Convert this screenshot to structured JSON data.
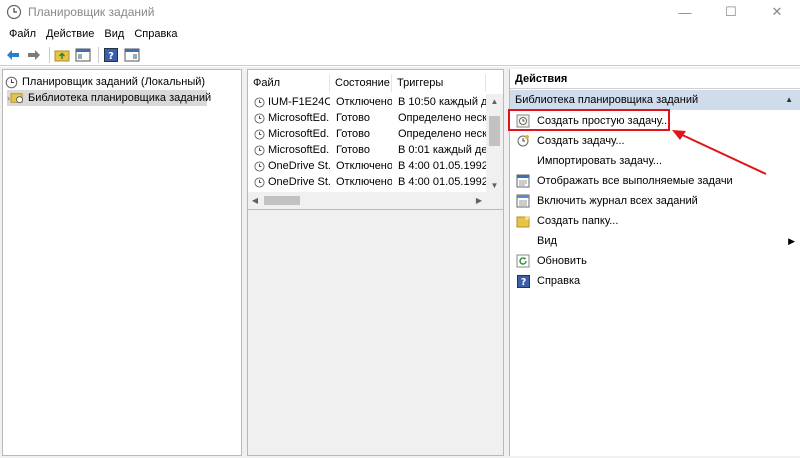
{
  "window": {
    "title": "Планировщик заданий",
    "minimize": "—",
    "maximize": "☐",
    "close": "✕"
  },
  "menu": {
    "items": [
      "Файл",
      "Действие",
      "Вид",
      "Справка"
    ]
  },
  "toolbar": {
    "icons": [
      "back-arrow-icon",
      "forward-arrow-icon",
      "folder-up-icon",
      "show-hide-console-tree-icon",
      "help-icon",
      "action-pane-icon"
    ]
  },
  "tree": {
    "root": "Планировщик заданий (Локальный)",
    "child": "Библиотека планировщика заданий"
  },
  "table": {
    "columns": [
      "Файл",
      "Состояние",
      "Триггеры"
    ],
    "rows": [
      {
        "file": "IUM-F1E24C...",
        "status": "Отключено",
        "trigger": "В 10:50 каждый ден"
      },
      {
        "file": "MicrosoftEd...",
        "status": "Готово",
        "trigger": "Определено неско..."
      },
      {
        "file": "MicrosoftEd...",
        "status": "Готово",
        "trigger": "Определено неско..."
      },
      {
        "file": "MicrosoftEd...",
        "status": "Готово",
        "trigger": "В 0:01 каждый день"
      },
      {
        "file": "OneDrive St...",
        "status": "Отключено",
        "trigger": "В 4:00 01.05.1992 - ч"
      },
      {
        "file": "OneDrive St...",
        "status": "Отключено",
        "trigger": "В 4:00 01.05.1992 - ч"
      }
    ]
  },
  "actions": {
    "header": "Действия",
    "section": "Библиотека планировщика заданий",
    "items": [
      {
        "label": "Создать простую задачу...",
        "icon": "create-basic-task-icon"
      },
      {
        "label": "Создать задачу...",
        "icon": "create-task-icon"
      },
      {
        "label": "Импортировать задачу...",
        "icon": "none"
      },
      {
        "label": "Отображать все выполняемые задачи",
        "icon": "running-tasks-icon"
      },
      {
        "label": "Включить журнал всех заданий",
        "icon": "history-log-icon"
      },
      {
        "label": "Создать папку...",
        "icon": "new-folder-icon"
      },
      {
        "label": "Вид",
        "icon": "none"
      },
      {
        "label": "Обновить",
        "icon": "refresh-icon"
      },
      {
        "label": "Справка",
        "icon": "help-icon"
      }
    ]
  },
  "colors": {
    "highlight": "#e2131a",
    "section_bg": "#cfdcec"
  }
}
